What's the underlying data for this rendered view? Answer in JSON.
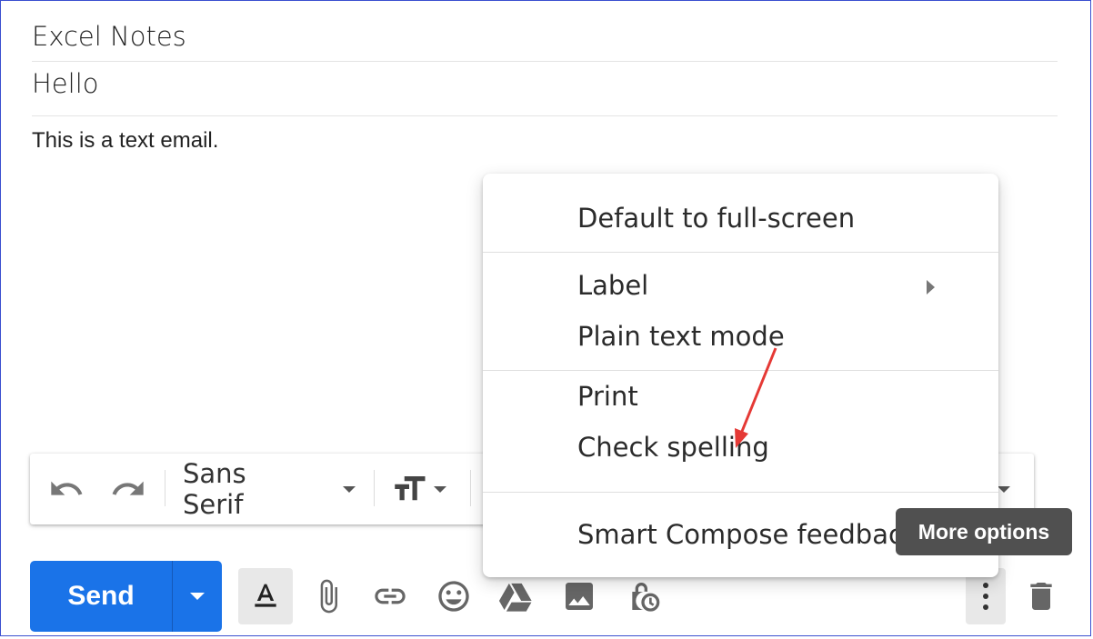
{
  "compose": {
    "to": "Excel Notes",
    "subject": "Hello",
    "body": "This is a text email."
  },
  "format_toolbar": {
    "font": "Sans Serif"
  },
  "bottom_bar": {
    "send_label": "Send",
    "accent_color": "#1a73e8"
  },
  "menu": {
    "items": [
      {
        "label": "Default to full-screen"
      },
      {
        "label": "Label"
      },
      {
        "label": "Plain text mode"
      },
      {
        "label": "Print"
      },
      {
        "label": "Check spelling"
      },
      {
        "label": "Smart Compose feedback"
      }
    ]
  },
  "tooltip": {
    "text": "More options"
  },
  "annotation": {
    "arrow_color": "#e53935"
  }
}
